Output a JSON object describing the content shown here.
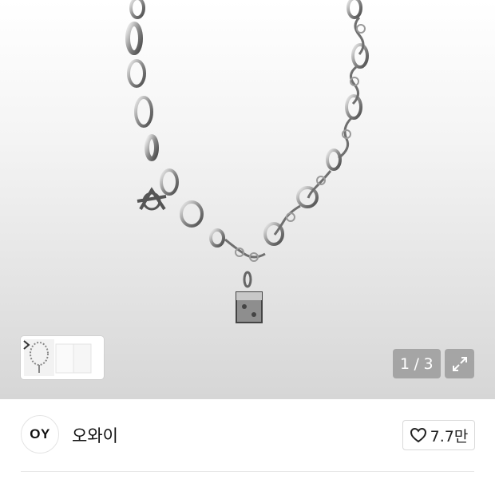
{
  "gallery": {
    "counter_current": "1",
    "counter_separator": "/",
    "counter_total": "3",
    "icons": {
      "thumbnail_next": "chevron-right-icon",
      "expand": "expand-arrows-icon"
    }
  },
  "brand": {
    "logo_text": "OY",
    "name": "오와이"
  },
  "like": {
    "icon": "heart-outline-icon",
    "count": "7.7만"
  },
  "colors": {
    "text": "#111111",
    "overlay": "#787878",
    "border": "#d9d9d9"
  }
}
